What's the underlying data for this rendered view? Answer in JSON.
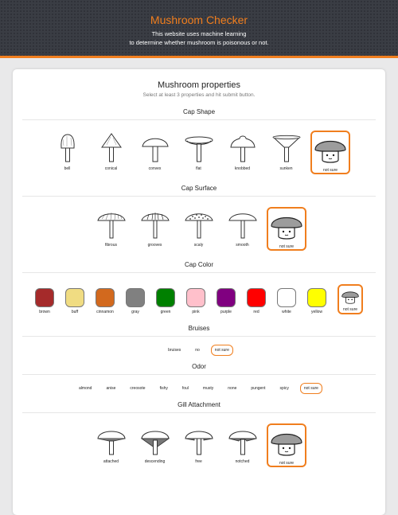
{
  "header": {
    "title": "Mushroom Checker",
    "line1": "This website uses machine learning",
    "line2": "to determine whether mushroom is poisonous or not."
  },
  "card": {
    "title": "Mushroom properties",
    "subtitle": "Select at least 3 properties and hit submit button."
  },
  "sections": {
    "cap_shape": {
      "title": "Cap Shape",
      "options": [
        "bell",
        "conical",
        "convex",
        "flat",
        "knobbed",
        "sunken"
      ],
      "not_sure": "not sure"
    },
    "cap_surface": {
      "title": "Cap Surface",
      "options": [
        "fibrous",
        "grooves",
        "scaly",
        "smooth"
      ],
      "not_sure": "not sure"
    },
    "cap_color": {
      "title": "Cap Color",
      "options": [
        {
          "label": "brown",
          "color": "#a52a2a"
        },
        {
          "label": "buff",
          "color": "#f0dc82"
        },
        {
          "label": "cinnamon",
          "color": "#d2691e"
        },
        {
          "label": "gray",
          "color": "#808080"
        },
        {
          "label": "green",
          "color": "#008000"
        },
        {
          "label": "pink",
          "color": "#ffc0cb"
        },
        {
          "label": "purple",
          "color": "#800080"
        },
        {
          "label": "red",
          "color": "#ff0000"
        },
        {
          "label": "white",
          "color": "#ffffff"
        },
        {
          "label": "yellow",
          "color": "#ffff00"
        }
      ],
      "not_sure": "not sure"
    },
    "bruises": {
      "title": "Bruises",
      "options": [
        "bruises",
        "no"
      ],
      "not_sure": "not sure"
    },
    "odor": {
      "title": "Odor",
      "options": [
        "almond",
        "anise",
        "creosote",
        "fishy",
        "foul",
        "musty",
        "none",
        "pungent",
        "spicy"
      ],
      "not_sure": "not sure"
    },
    "gill_attachment": {
      "title": "Gill Attachment",
      "options": [
        "attached",
        "descending",
        "free",
        "notched"
      ],
      "not_sure": "not sure"
    }
  },
  "accent_color": "#f07e1e"
}
